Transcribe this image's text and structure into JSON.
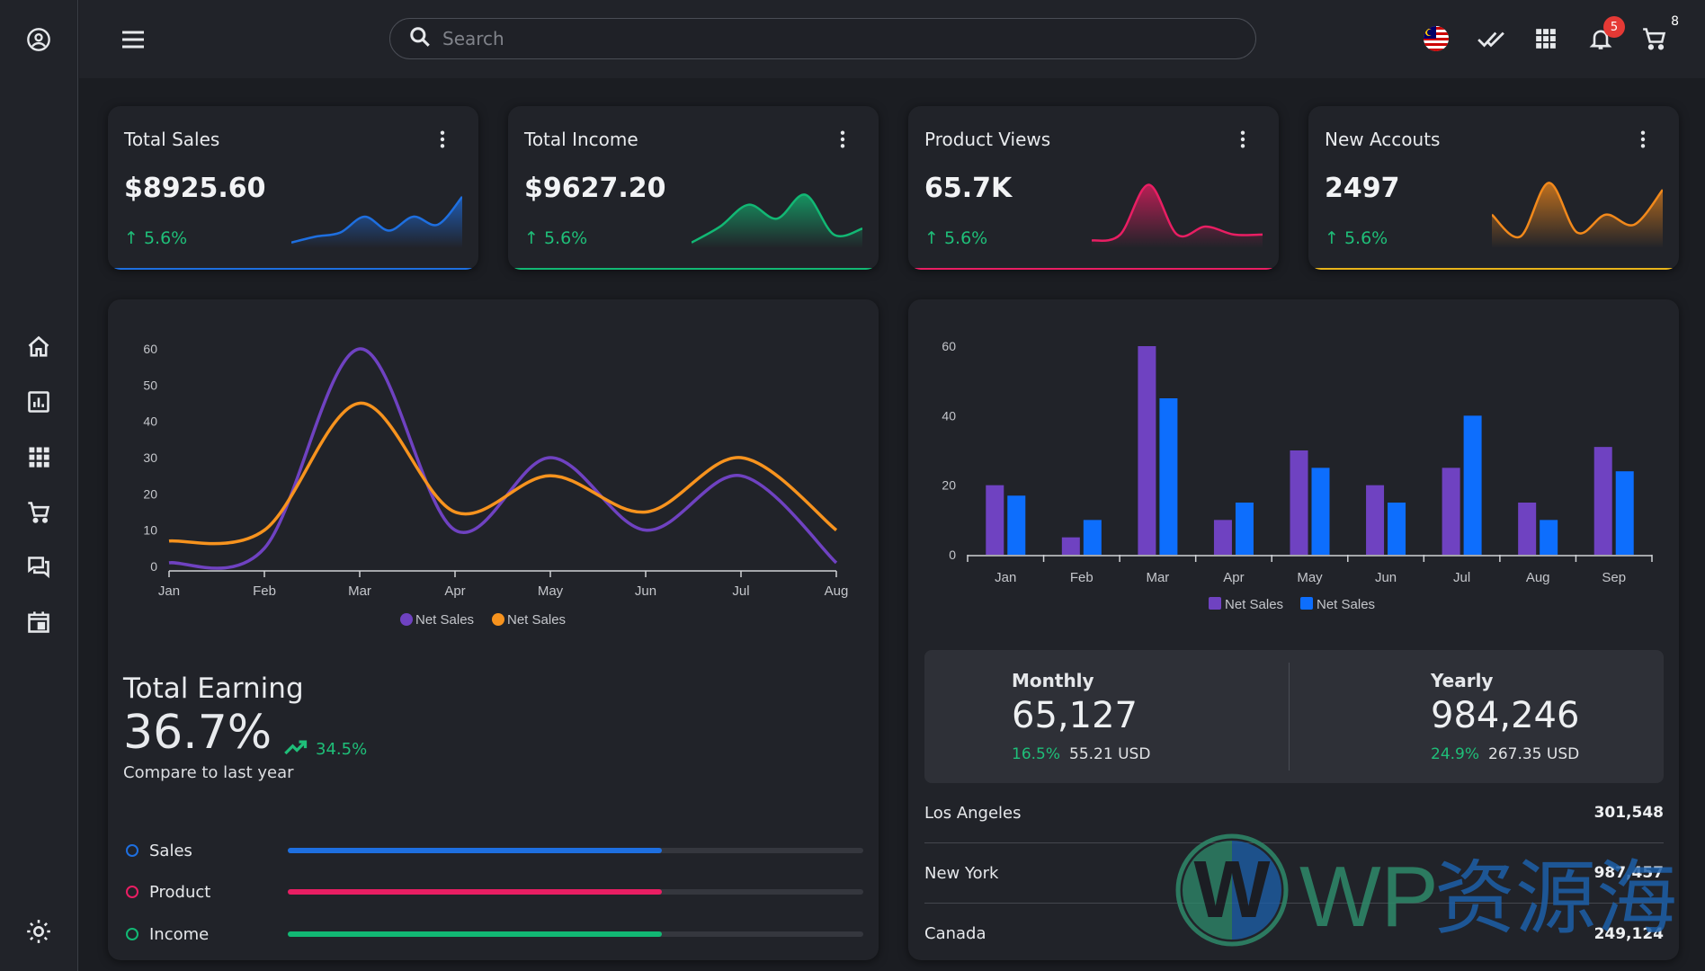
{
  "header": {
    "search_placeholder": "Search",
    "notification_count": "5",
    "cart_count": "8",
    "language_flag": "malaysia-flag"
  },
  "sidebar": {
    "top_icon": "account-circle-icon",
    "items": [
      {
        "icon": "home-icon",
        "name": "home"
      },
      {
        "icon": "chart-icon",
        "name": "analytics"
      },
      {
        "icon": "apps-icon",
        "name": "apps"
      },
      {
        "icon": "cart-icon",
        "name": "shop"
      },
      {
        "icon": "chat-icon",
        "name": "messages"
      },
      {
        "icon": "calendar-icon",
        "name": "calendar"
      }
    ],
    "bottom_icon": "sun-icon"
  },
  "cards": [
    {
      "title": "Total Sales",
      "value": "$8925.60",
      "change": "5.6%",
      "color": "#1e6fe0",
      "spark": [
        2,
        8,
        12,
        28,
        14,
        28,
        20,
        48
      ]
    },
    {
      "title": "Total Income",
      "value": "$9627.20",
      "change": "5.6%",
      "color": "#12b874",
      "spark": [
        2,
        18,
        40,
        26,
        50,
        10,
        16
      ]
    },
    {
      "title": "Product Views",
      "value": "65.7K",
      "change": "5.6%",
      "color": "#e91e63",
      "spark": [
        4,
        10,
        60,
        10,
        18,
        10,
        10
      ]
    },
    {
      "title": "New Accouts",
      "value": "2497",
      "change": "5.6%",
      "color": "#f2891b",
      "spark": [
        30,
        8,
        62,
        12,
        30,
        20,
        55
      ]
    }
  ],
  "line_chart_data": {
    "type": "line",
    "categories": [
      "Jan",
      "Feb",
      "Mar",
      "Apr",
      "May",
      "Jun",
      "Jul",
      "Aug"
    ],
    "series": [
      {
        "name": "Net Sales",
        "color": "#6f42c1",
        "values": [
          1,
          5,
          60,
          10,
          30,
          10,
          25,
          1
        ]
      },
      {
        "name": "Net Sales",
        "color": "#f7931e",
        "values": [
          7,
          10,
          45,
          15,
          25,
          15,
          30,
          10
        ]
      }
    ],
    "yticks": [
      0,
      10,
      20,
      30,
      40,
      50,
      60
    ],
    "ylim": [
      0,
      60
    ],
    "legend": "bottom"
  },
  "chart_data": {
    "type": "bar",
    "title": "",
    "xlabel": "",
    "ylabel": "",
    "categories": [
      "Jan",
      "Feb",
      "Mar",
      "Apr",
      "May",
      "Jun",
      "Jul",
      "Aug",
      "Sep"
    ],
    "series": [
      {
        "name": "Net Sales",
        "color": "#6f42c1",
        "values": [
          20,
          5,
          60,
          10,
          30,
          20,
          25,
          15,
          31
        ]
      },
      {
        "name": "Net Sales",
        "color": "#0d6efd",
        "values": [
          17,
          10,
          45,
          15,
          25,
          15,
          40,
          10,
          24
        ]
      }
    ],
    "yticks": [
      0,
      20,
      40,
      60
    ],
    "ylim": [
      0,
      60
    ],
    "legend": "bottom"
  },
  "earning": {
    "title": "Total Earning",
    "value": "36.7%",
    "trend": "34.5%",
    "subtitle": "Compare to last year",
    "progress": [
      {
        "label": "Sales",
        "percent": 65,
        "color": "#1e6fe0"
      },
      {
        "label": "Product",
        "percent": 65,
        "color": "#e91e63"
      },
      {
        "label": "Income",
        "percent": 65,
        "color": "#12b874"
      }
    ]
  },
  "stats": {
    "monthly": {
      "label": "Monthly",
      "value": "65,127",
      "pct": "16.5%",
      "usd": "55.21 USD"
    },
    "yearly": {
      "label": "Yearly",
      "value": "984,246",
      "pct": "24.9%",
      "usd": "267.35 USD"
    }
  },
  "cities": [
    {
      "name": "Los Angeles",
      "value": "301,548"
    },
    {
      "name": "New York",
      "value": "987,457"
    },
    {
      "name": "Canada",
      "value": "249,124"
    }
  ],
  "watermark": {
    "text": "WP资源海"
  }
}
